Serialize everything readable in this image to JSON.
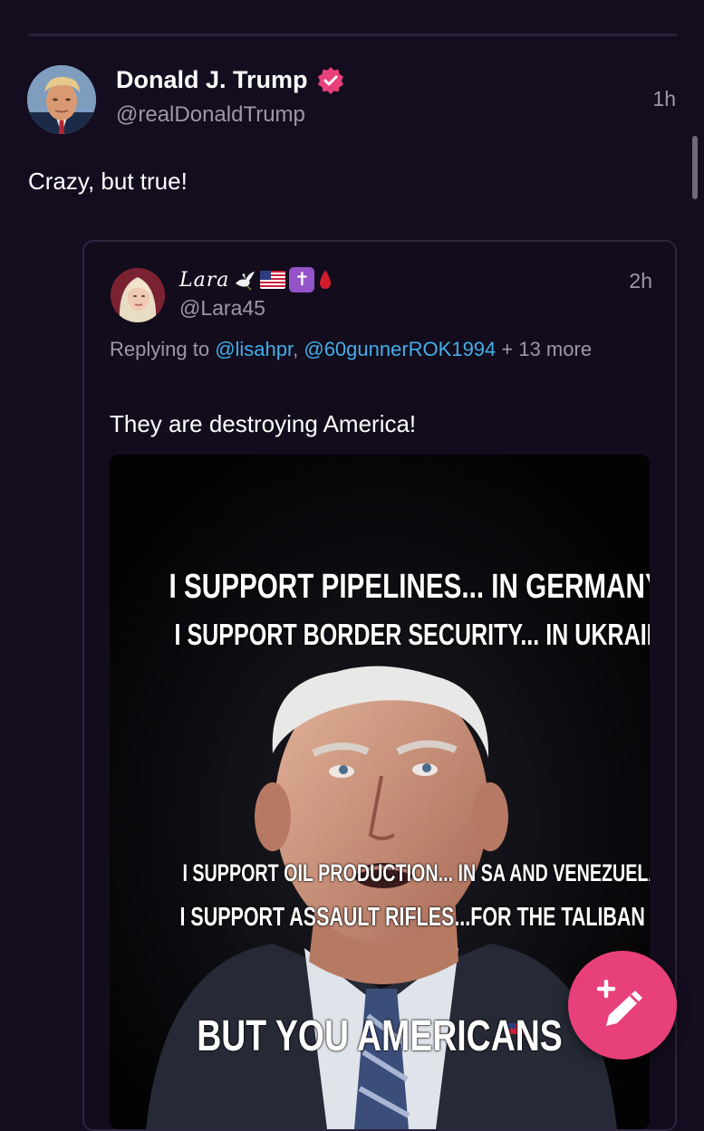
{
  "post": {
    "author_name": "Donald J. Trump",
    "author_handle": "@realDonaldTrump",
    "timestamp": "1h",
    "text": "Crazy, but true!",
    "verified_icon": "verified-badge-icon",
    "avatar_icon": "user-avatar"
  },
  "quote": {
    "author_name": "Lara",
    "name_emojis": [
      "dove",
      "us-flag",
      "latin-cross",
      "red-drop"
    ],
    "author_handle": "@Lara45",
    "timestamp": "2h",
    "replying_prefix": "Replying to ",
    "mention_1": "@lisahpr",
    "separator": ", ",
    "mention_2": "@60gunnerROK1994",
    "replying_suffix": " + 13 more",
    "text": "They are destroying America!",
    "image": {
      "line_1": "I SUPPORT PIPELINES... IN GERMANY.",
      "line_2": "I SUPPORT BORDER SECURITY... IN UKRAINE",
      "line_3": "I SUPPORT OIL PRODUCTION... IN SA AND VENEZUELA",
      "line_4": "I SUPPORT ASSAULT RIFLES...FOR THE TALIBAN",
      "line_5": "BUT YOU AMERICANS"
    }
  },
  "compose_button": {
    "icon": "compose-pencil-icon"
  },
  "colors": {
    "background": "#140d1f",
    "accent": "#e8407a",
    "mention": "#43aee8",
    "muted_text": "#9d98a6"
  }
}
